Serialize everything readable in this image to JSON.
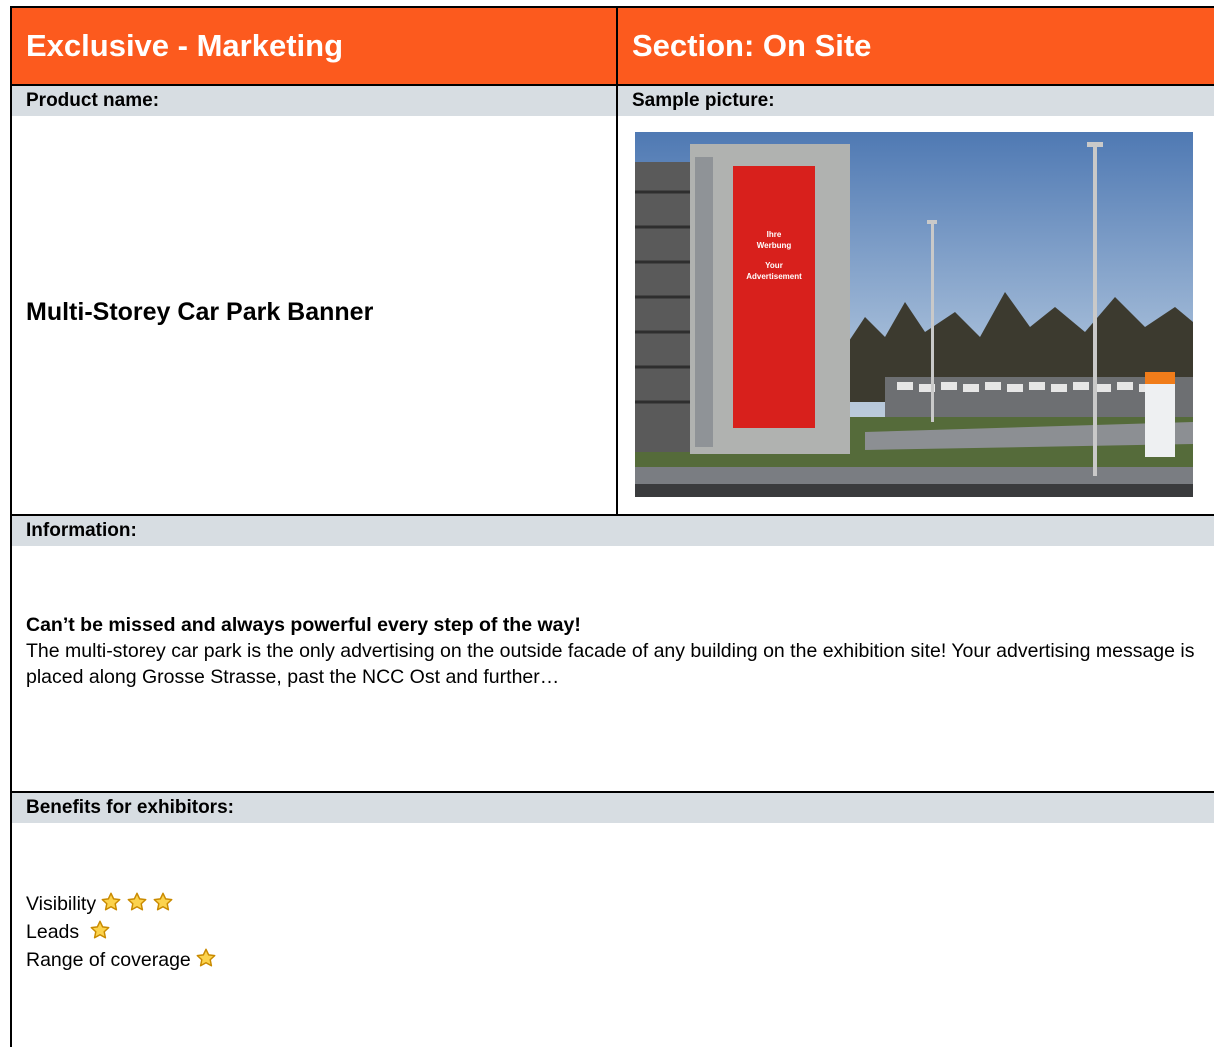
{
  "header": {
    "left_title": "Exclusive - Marketing",
    "right_title": "Section: On Site"
  },
  "labels": {
    "product_name": "Product name:",
    "sample_picture": "Sample picture:",
    "information": "Information:",
    "benefits": "Benefits for exhibitors:"
  },
  "product": {
    "name": "Multi-Storey Car Park Banner"
  },
  "photo": {
    "banner_line1": "Ihre",
    "banner_line2": "Werbung",
    "banner_line3": "Your",
    "banner_line4": "Advertisement",
    "banner_color": "#d8201c"
  },
  "information": {
    "tagline": "Can’t be missed and always powerful every step of the way!",
    "body": "The multi-storey car park is the only advertising on the outside facade of any building on the exhibition site! Your advertising message is placed along Grosse Strasse, past the NCC Ost and further…"
  },
  "benefits": [
    {
      "label": "Visibility",
      "stars": 3
    },
    {
      "label": "Leads ",
      "stars": 1
    },
    {
      "label": "Range of coverage",
      "stars": 1
    }
  ],
  "colors": {
    "header_bg": "#fc5a1e",
    "label_bg": "#d7dde2",
    "star_fill": "#fcd34d",
    "star_stroke": "#c98a00"
  }
}
